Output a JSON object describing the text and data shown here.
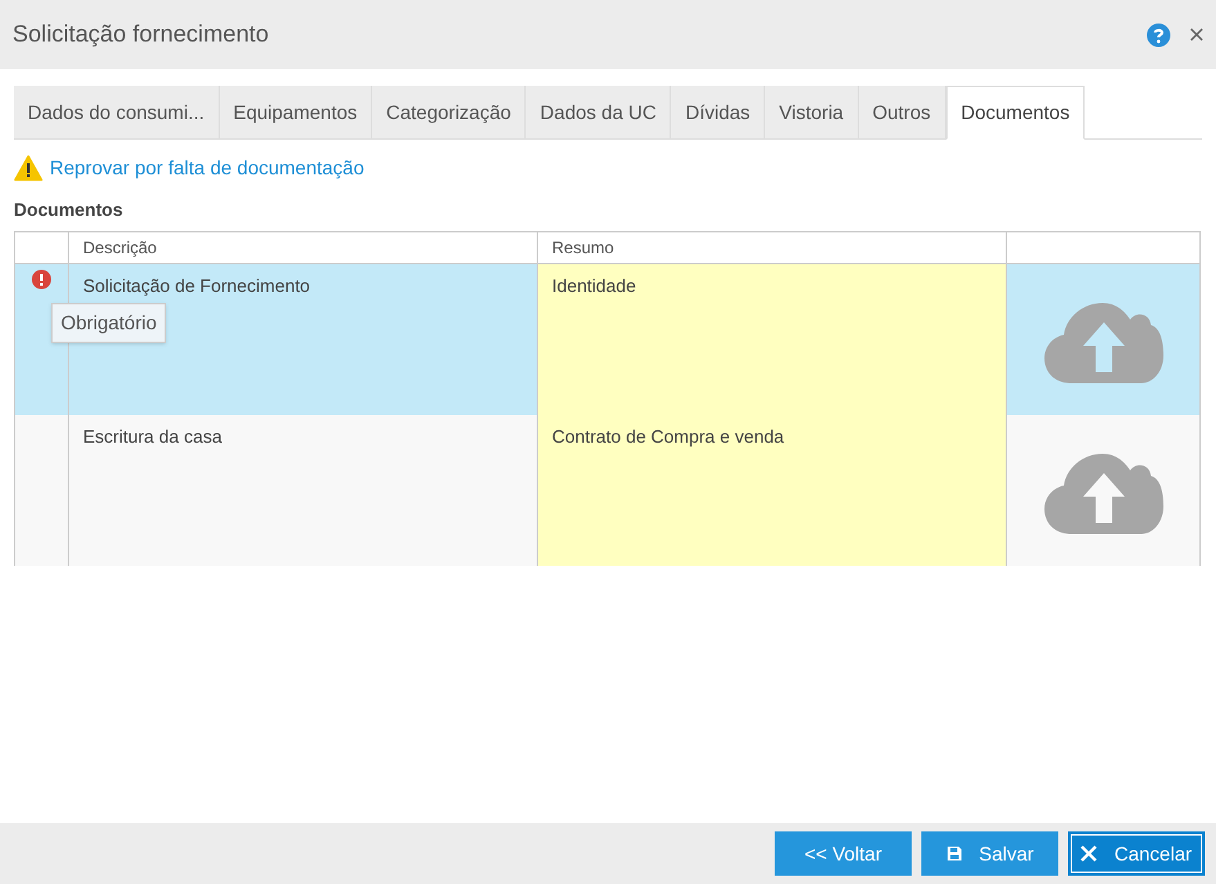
{
  "window": {
    "title": "Solicitação fornecimento"
  },
  "tabs": [
    {
      "label": "Dados do consumi...",
      "selected": false
    },
    {
      "label": "Equipamentos",
      "selected": false
    },
    {
      "label": "Categorização",
      "selected": false
    },
    {
      "label": "Dados da UC",
      "selected": false
    },
    {
      "label": "Dívidas",
      "selected": false
    },
    {
      "label": "Vistoria",
      "selected": false
    },
    {
      "label": "Outros",
      "selected": false
    },
    {
      "label": "Documentos",
      "selected": true
    }
  ],
  "warning_link": "Reprovar por falta de documentação",
  "section_title": "Documentos",
  "table": {
    "columns": [
      "Descrição",
      "Resumo"
    ],
    "rows": [
      {
        "descricao": "Solicitação de Fornecimento",
        "resumo": "Identidade",
        "selected": true,
        "required": true,
        "tooltip": "Obrigatório"
      },
      {
        "descricao": "Escritura da casa",
        "resumo": "Contrato de Compra e venda",
        "selected": false,
        "required": false
      }
    ]
  },
  "buttons": [
    {
      "kind": "back",
      "label": "<< Voltar",
      "focused": false
    },
    {
      "kind": "save",
      "label": "Salvar",
      "focused": false
    },
    {
      "kind": "cancel",
      "label": "Cancelar",
      "focused": true
    }
  ]
}
